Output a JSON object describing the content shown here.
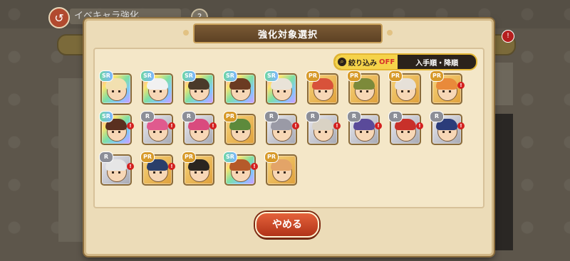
{
  "background": {
    "screen_title": "イベキャラ強化",
    "help_label": "?",
    "notification_count": "!"
  },
  "modal": {
    "title": "強化対象選択",
    "filter": {
      "label": "絞り込み",
      "state": "OFF",
      "sort_label": "入手順・降順"
    },
    "cancel_label": "やめる"
  },
  "cards": [
    {
      "rank": "SR",
      "frame": "rainbow",
      "hair": "#f2e0b0",
      "badge": ""
    },
    {
      "rank": "SR",
      "frame": "rainbow",
      "hair": "#f1f1f1",
      "badge": ""
    },
    {
      "rank": "SR",
      "frame": "rainbow",
      "hair": "#4a3a2a",
      "badge": ""
    },
    {
      "rank": "SR",
      "frame": "rainbow",
      "hair": "#6b3b22",
      "badge": ""
    },
    {
      "rank": "SR",
      "frame": "rainbow",
      "hair": "#e9e3d8",
      "badge": ""
    },
    {
      "rank": "PR",
      "frame": "gold",
      "hair": "#d8523a",
      "badge": ""
    },
    {
      "rank": "PR",
      "frame": "gold",
      "hair": "#7c8a3a",
      "badge": ""
    },
    {
      "rank": "PR",
      "frame": "gold",
      "hair": "#e6e0d8",
      "badge": ""
    },
    {
      "rank": "PR",
      "frame": "gold",
      "hair": "#e98a3a",
      "badge": "!"
    },
    {
      "rank": "SR",
      "frame": "rainbow",
      "hair": "#5a3020",
      "badge": "!"
    },
    {
      "rank": "R",
      "frame": "silver",
      "hair": "#e05a8e",
      "badge": "!"
    },
    {
      "rank": "R",
      "frame": "silver",
      "hair": "#d94b7e",
      "badge": "!"
    },
    {
      "rank": "PR",
      "frame": "gold",
      "hair": "#5d8a3c",
      "badge": ""
    },
    {
      "rank": "R",
      "frame": "silver",
      "hair": "#9a9aa6",
      "badge": "!"
    },
    {
      "rank": "R",
      "frame": "silver",
      "hair": "#d9d2c4",
      "badge": "!"
    },
    {
      "rank": "R",
      "frame": "silver",
      "hair": "#5a4a9a",
      "badge": "!"
    },
    {
      "rank": "R",
      "frame": "silver",
      "hair": "#c8302a",
      "badge": "!"
    },
    {
      "rank": "R",
      "frame": "silver",
      "hair": "#2b3c7a",
      "badge": "!"
    },
    {
      "rank": "R",
      "frame": "silver",
      "hair": "#e6e6e6",
      "badge": "!"
    },
    {
      "rank": "PR",
      "frame": "gold",
      "hair": "#2a3e6a",
      "badge": "!"
    },
    {
      "rank": "PR",
      "frame": "gold",
      "hair": "#2a2520",
      "badge": ""
    },
    {
      "rank": "SR",
      "frame": "rainbow",
      "hair": "#b55a2a",
      "badge": "!"
    },
    {
      "rank": "PR",
      "frame": "gold",
      "hair": "#e3a468",
      "badge": ""
    }
  ]
}
